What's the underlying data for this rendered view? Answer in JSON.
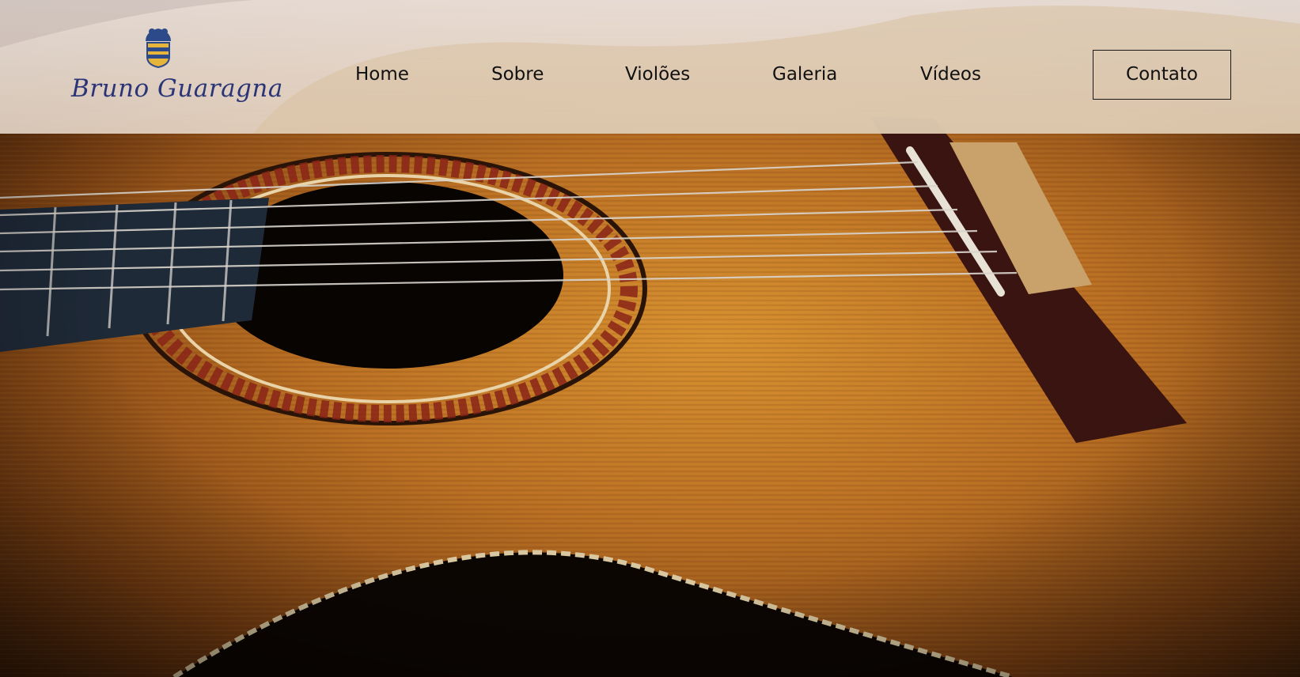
{
  "brand": {
    "name": "Bruno Guaragna",
    "logo_icon": "coat-of-arms-icon",
    "text_color": "#2a3476"
  },
  "nav": {
    "items": [
      {
        "label": "Home"
      },
      {
        "label": "Sobre"
      },
      {
        "label": "Violões"
      },
      {
        "label": "Galeria"
      },
      {
        "label": "Vídeos"
      }
    ],
    "contact_label": "Contato"
  },
  "hero": {
    "image": "classical-guitar-closeup",
    "accent_color": "#c07a2a"
  }
}
